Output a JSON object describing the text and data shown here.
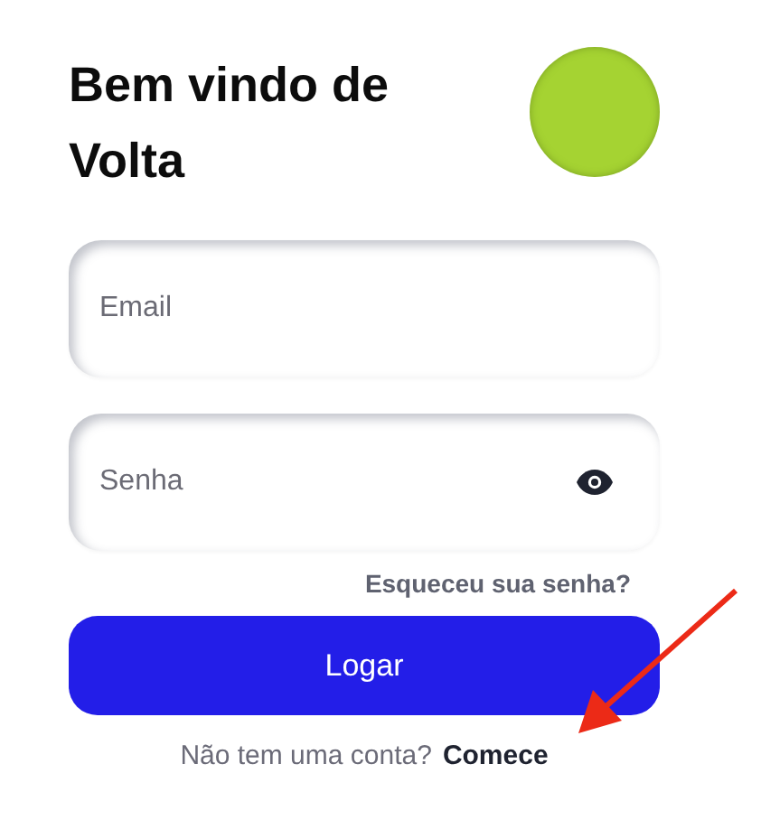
{
  "title": "Bem vindo de Volta",
  "fields": [
    {
      "kind": "text",
      "placeholder": "Email"
    },
    {
      "kind": "password",
      "placeholder": "Senha"
    }
  ],
  "forgot_link": "Esqueceu sua senha?",
  "login_button": "Logar",
  "signup": {
    "prompt": "Não tem uma conta?",
    "link": "Comece"
  }
}
